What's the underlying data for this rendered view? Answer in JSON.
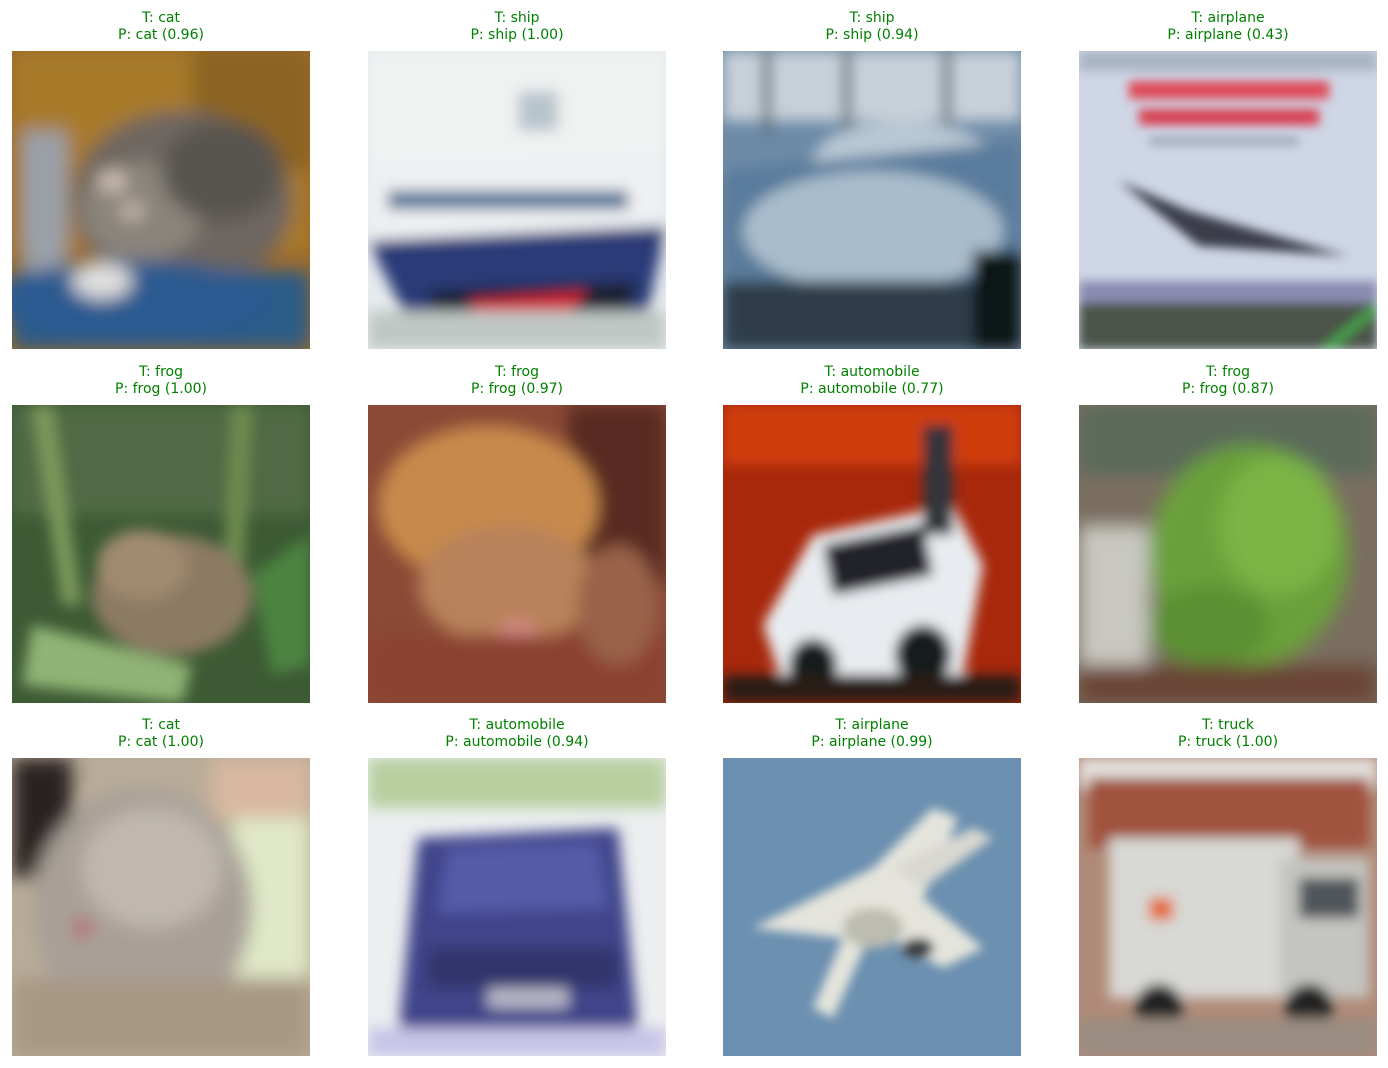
{
  "figure": {
    "text_color": "#008000",
    "tiles": [
      {
        "true_label": "T: cat",
        "pred_label": "P: cat (0.96)",
        "subject": "cat",
        "true_class": "cat",
        "pred_class": "cat",
        "confidence": 0.96
      },
      {
        "true_label": "T: ship",
        "pred_label": "P: ship (1.00)",
        "subject": "ship",
        "true_class": "ship",
        "pred_class": "ship",
        "confidence": 1.0
      },
      {
        "true_label": "T: ship",
        "pred_label": "P: ship (0.94)",
        "subject": "ship",
        "true_class": "ship",
        "pred_class": "ship",
        "confidence": 0.94
      },
      {
        "true_label": "T: airplane",
        "pred_label": "P: airplane (0.43)",
        "subject": "airplane",
        "true_class": "airplane",
        "pred_class": "airplane",
        "confidence": 0.43
      },
      {
        "true_label": "T: frog",
        "pred_label": "P: frog (1.00)",
        "subject": "frog",
        "true_class": "frog",
        "pred_class": "frog",
        "confidence": 1.0
      },
      {
        "true_label": "T: frog",
        "pred_label": "P: frog (0.97)",
        "subject": "frog",
        "true_class": "frog",
        "pred_class": "frog",
        "confidence": 0.97
      },
      {
        "true_label": "T: automobile",
        "pred_label": "P: automobile (0.77)",
        "subject": "automobile",
        "true_class": "automobile",
        "pred_class": "automobile",
        "confidence": 0.77
      },
      {
        "true_label": "T: frog",
        "pred_label": "P: frog (0.87)",
        "subject": "frog",
        "true_class": "frog",
        "pred_class": "frog",
        "confidence": 0.87
      },
      {
        "true_label": "T: cat",
        "pred_label": "P: cat (1.00)",
        "subject": "cat",
        "true_class": "cat",
        "pred_class": "cat",
        "confidence": 1.0
      },
      {
        "true_label": "T: automobile",
        "pred_label": "P: automobile (0.94)",
        "subject": "automobile",
        "true_class": "automobile",
        "pred_class": "automobile",
        "confidence": 0.94
      },
      {
        "true_label": "T: airplane",
        "pred_label": "P: airplane (0.99)",
        "subject": "airplane",
        "true_class": "airplane",
        "pred_class": "airplane",
        "confidence": 0.99
      },
      {
        "true_label": "T: truck",
        "pred_label": "P: truck (1.00)",
        "subject": "truck",
        "true_class": "truck",
        "pred_class": "truck",
        "confidence": 1.0
      }
    ]
  }
}
